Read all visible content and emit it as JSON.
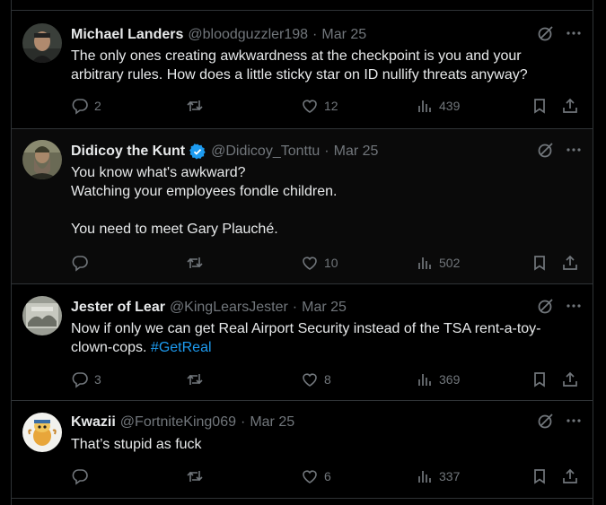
{
  "tweets": [
    {
      "name": "Michael Landers",
      "handle": "@bloodguzzler198",
      "date": "Mar 25",
      "verified": false,
      "lines": [
        "The only ones creating awkwardness at the checkpoint is you and your arbitrary rules. How does a little sticky star on ID nullify threats anyway?"
      ],
      "replies": "2",
      "reposts": "",
      "likes": "12",
      "views": "439"
    },
    {
      "name": "Didicoy the Kunt",
      "handle": "@Didicoy_Tonttu",
      "date": "Mar 25",
      "verified": true,
      "lines": [
        "You know what's awkward?",
        "Watching your employees fondle children.",
        "",
        "You need to meet Gary Plauché."
      ],
      "replies": "",
      "reposts": "",
      "likes": "10",
      "views": "502"
    },
    {
      "name": "Jester of Lear",
      "handle": "@KingLearsJester",
      "date": "Mar 25",
      "verified": false,
      "text_before_hashtag": "Now if only we can get Real Airport Security instead of the TSA rent-a-toy-clown-cops. ",
      "hashtag": "#GetReal",
      "replies": "3",
      "reposts": "",
      "likes": "8",
      "views": "369"
    },
    {
      "name": "Kwazii",
      "handle": "@FortniteKing069",
      "date": "Mar 25",
      "verified": false,
      "lines": [
        "That’s stupid as fuck"
      ],
      "replies": "",
      "reposts": "",
      "likes": "6",
      "views": "337"
    }
  ],
  "separator": "·",
  "icons": {
    "reply": "reply-icon",
    "repost": "repost-icon",
    "like": "like-icon",
    "views": "views-icon",
    "bookmark": "bookmark-icon",
    "share": "share-icon",
    "grok": "grok-icon",
    "more": "more-icon",
    "verified": "verified-badge-icon"
  },
  "colors": {
    "background": "#000000",
    "text": "#e7e9ea",
    "muted": "#71767b",
    "border": "#2f3336",
    "link": "#1d9bf0"
  }
}
